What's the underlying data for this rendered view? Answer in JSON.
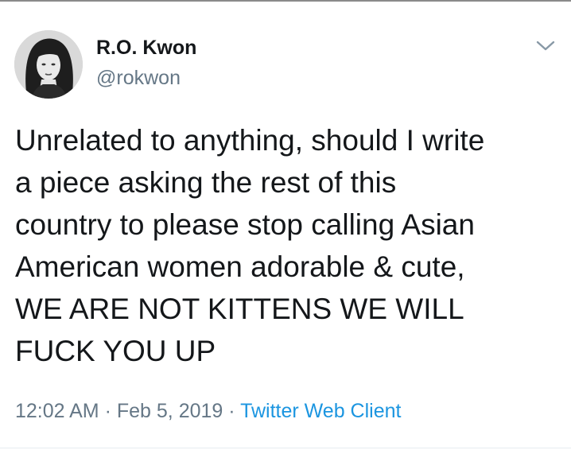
{
  "tweet": {
    "author_name": "R.O. Kwon",
    "author_handle": "@rokwon",
    "text": "Unrelated to anything, should I write\na piece asking the rest of this\ncountry to please stop calling Asian\nAmerican women adorable & cute,\nWE ARE NOT KITTENS WE WILL\nFUCK YOU UP",
    "time": "12:02 AM",
    "separator": "·",
    "date": "Feb 5, 2019",
    "client": "Twitter Web Client",
    "menu_icon": "chevron-down-icon",
    "avatar_icon": "profile-photo"
  },
  "colors": {
    "text": "#14171a",
    "secondary": "#657786",
    "link": "#1b95e0",
    "caret": "#8899a6"
  }
}
